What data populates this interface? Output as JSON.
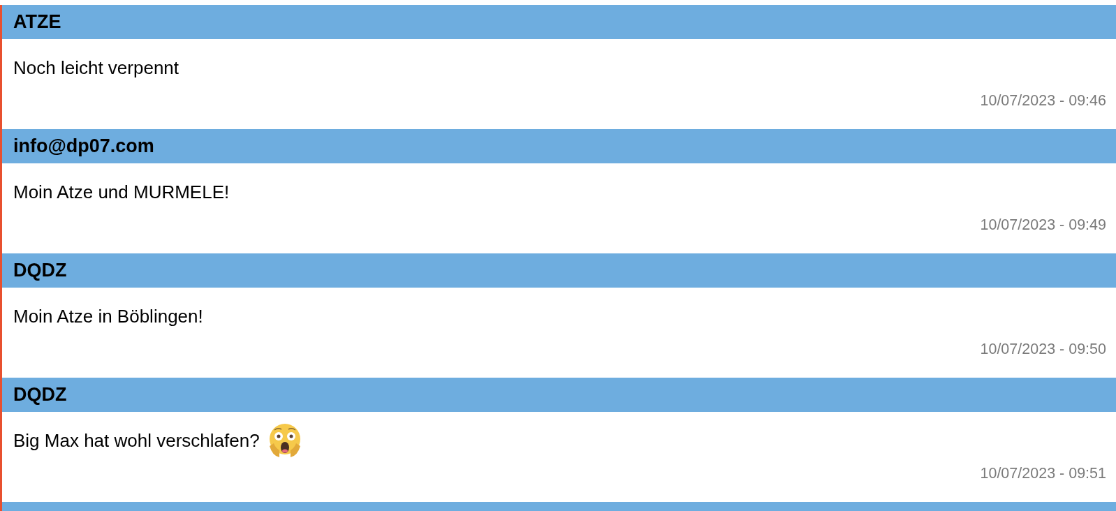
{
  "messages": [
    {
      "author": "ATZE",
      "text": "Noch leicht verpennt",
      "time": "10/07/2023 - 09:46",
      "emoji": false
    },
    {
      "author": "info@dp07.com",
      "text": "Moin Atze und MURMELE!",
      "time": "10/07/2023 - 09:49",
      "emoji": false
    },
    {
      "author": "DQDZ",
      "text": "Moin Atze in Böblingen!",
      "time": "10/07/2023 - 09:50",
      "emoji": false
    },
    {
      "author": "DQDZ",
      "text": "Big Max hat wohl verschlafen?",
      "time": "10/07/2023 - 09:51",
      "emoji": true
    }
  ]
}
